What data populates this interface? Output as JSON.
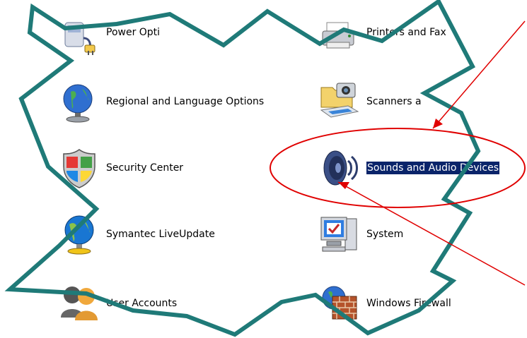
{
  "control_panel": {
    "items": [
      {
        "label": "Power Opti",
        "icon": "power-options-icon"
      },
      {
        "label": "Printers and Fax",
        "icon": "printers-icon"
      },
      {
        "label": "Regional and Language Options",
        "icon": "globe-icon"
      },
      {
        "label": "Scanners a",
        "icon": "scanner-camera-icon"
      },
      {
        "label": "Security Center",
        "icon": "security-shield-icon"
      },
      {
        "label": "Sounds and Audio Devices",
        "icon": "speaker-icon",
        "selected": true
      },
      {
        "label": "Symantec LiveUpdate",
        "icon": "symantec-globe-icon"
      },
      {
        "label": "System",
        "icon": "system-computer-icon"
      },
      {
        "label": "User Accounts",
        "icon": "user-accounts-icon"
      },
      {
        "label": "Windows Firewall",
        "icon": "firewall-icon"
      }
    ]
  },
  "colors": {
    "teal_outline": "#1f7a78",
    "annotation_red": "#e00000",
    "selection_bg": "#0a246a"
  }
}
